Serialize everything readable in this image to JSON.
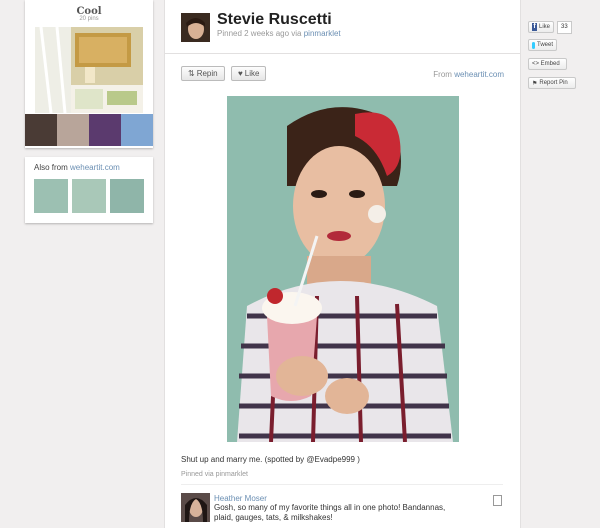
{
  "board": {
    "title": "Cool",
    "pin_count": "20 pins"
  },
  "also_from": {
    "label": "Also from",
    "source": "weheartit.com"
  },
  "pin": {
    "user_name": "Stevie Ruscetti",
    "pinned_prefix": "Pinned 2 weeks ago via",
    "pinned_source": "pinmarklet",
    "repin_label": "Repin",
    "like_label": "Like",
    "from_label": "From",
    "from_source": "weheartit.com",
    "caption": "Shut up and marry me. (spotted by @Evadpe999 )",
    "pinned_via_label": "Pinned via",
    "pinned_via_source": "pinmarklet"
  },
  "comment": {
    "author": "Heather Moser",
    "text": "Gosh, so many of my favorite things all in one photo! Bandannas, plaid, gauges, tats, & milkshakes!"
  },
  "share": {
    "like_label": "Like",
    "like_count": "33",
    "tweet_label": "Tweet",
    "embed_label": "<> Embed",
    "report_label": "Report Pin"
  },
  "colors": {
    "link": "#6b8fb3",
    "facebook": "#3b5998",
    "twitter": "#33ccff"
  }
}
